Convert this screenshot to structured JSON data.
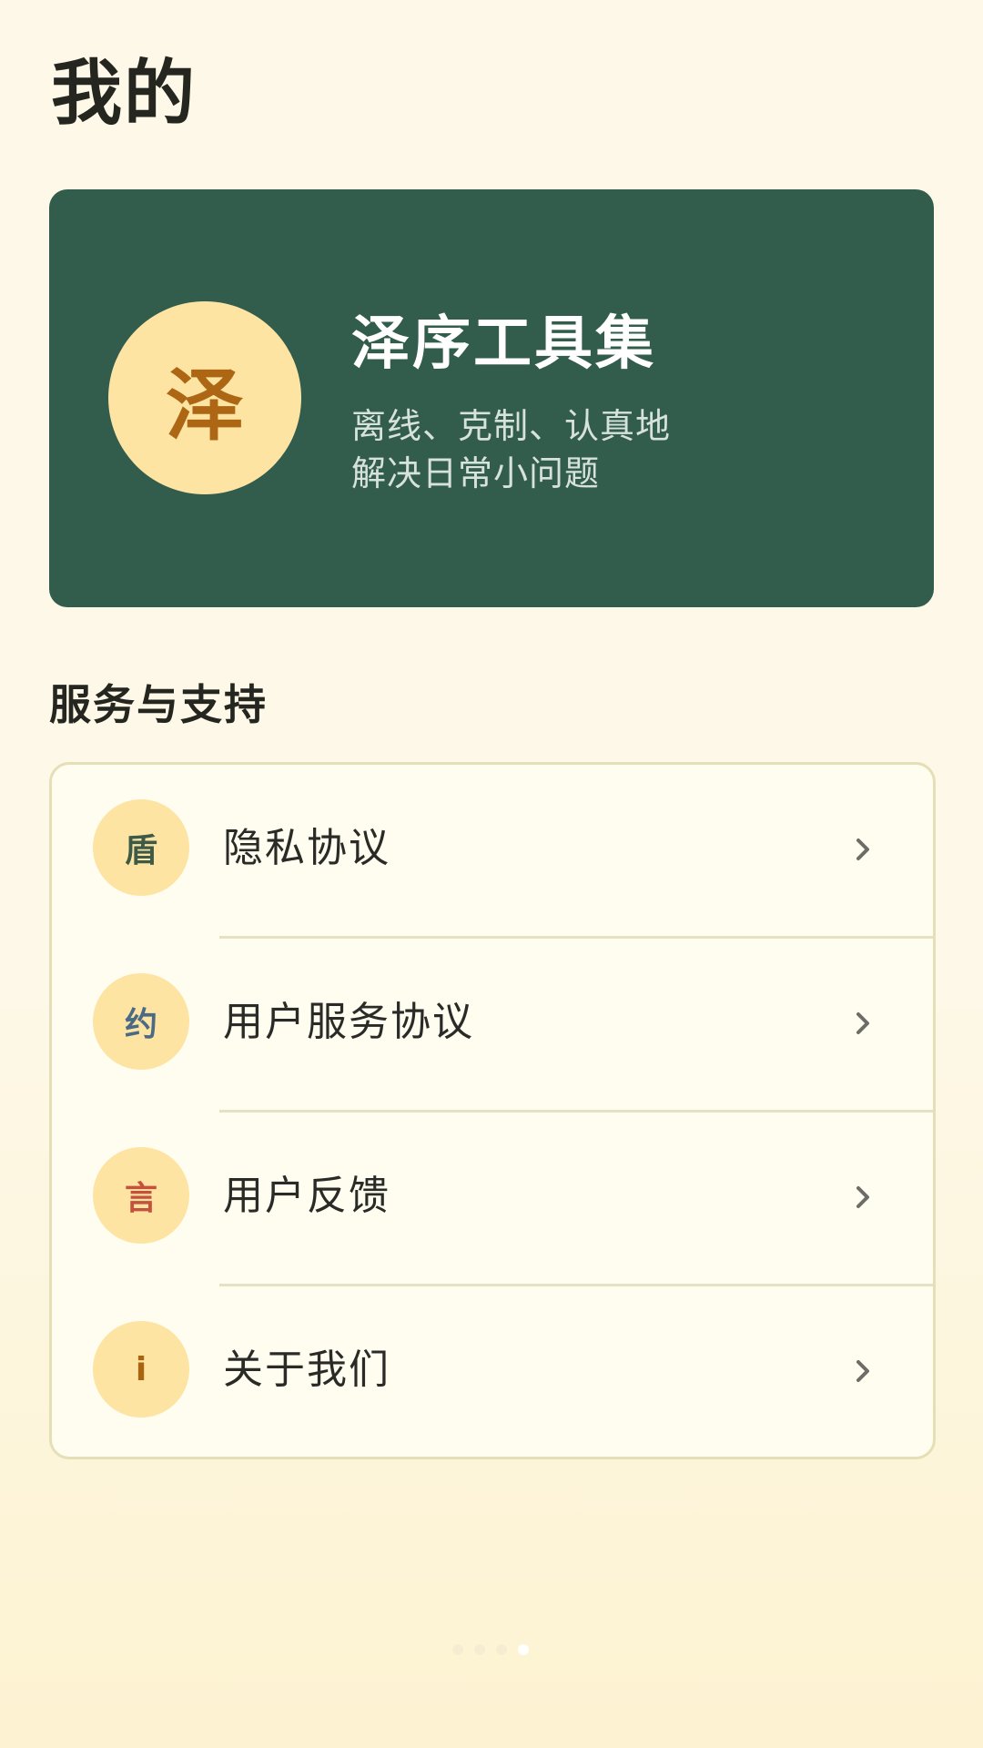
{
  "page": {
    "title": "我的"
  },
  "hero": {
    "avatar_char": "泽",
    "title": "泽序工具集",
    "subtitle_line1": "离线、克制、认真地",
    "subtitle_line2": "解决日常小问题"
  },
  "section": {
    "title": "服务与支持"
  },
  "menu": {
    "items": [
      {
        "icon_char": "盾",
        "icon_color": "#3d5a48",
        "label": "隐私协议"
      },
      {
        "icon_char": "约",
        "icon_color": "#4a6a85",
        "label": "用户服务协议"
      },
      {
        "icon_char": "言",
        "icon_color": "#c4513d",
        "label": "用户反馈"
      },
      {
        "icon_char": "i",
        "icon_color": "#a8640f",
        "label": "关于我们"
      }
    ]
  },
  "colors": {
    "hero_bg": "#325c4b",
    "accent_circle": "#fde4a2",
    "page_bg": "#fdf8e7"
  },
  "pager": {
    "count": 4,
    "active_index": 3
  }
}
